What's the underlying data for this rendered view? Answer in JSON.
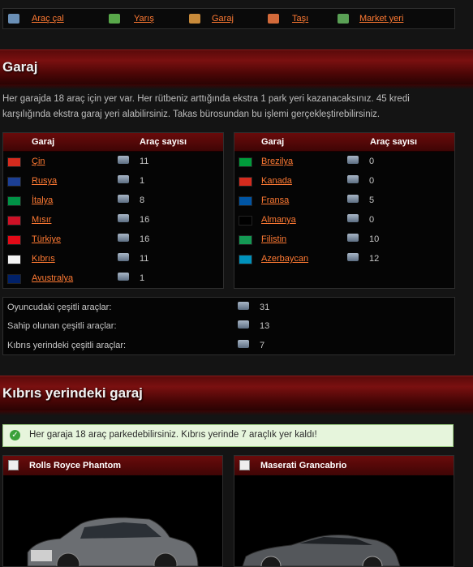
{
  "nav": [
    {
      "label": "Araç çal",
      "icon": "car-steal-icon",
      "color": "#6a8fb6"
    },
    {
      "label": "Yarış",
      "icon": "race-arrows-icon",
      "color": "#59a84a"
    },
    {
      "label": "Garaj",
      "icon": "garage-box-icon",
      "color": "#c88a3a"
    },
    {
      "label": "Taşı",
      "icon": "truck-icon",
      "color": "#d36a3a"
    },
    {
      "label": "Market yeri",
      "icon": "money-icon",
      "color": "#5aa055"
    }
  ],
  "garage_section": {
    "title": "Garaj",
    "intro": "Her garajda 18 araç için yer var. Her rütbeniz arttığında ekstra 1 park yeri kazanacaksınız. 45 kredi karşılığında ekstra garaj yeri alabilirsiniz. Takas bürosundan bu işlemi gerçekleştirebilirsiniz."
  },
  "table_headers": {
    "garage": "Garaj",
    "count": "Araç sayısı"
  },
  "left_garages": [
    {
      "name": "Çin",
      "count": "11",
      "flag": "#d52b1e"
    },
    {
      "name": "Rusya",
      "count": "1",
      "flag": "#1c3f94"
    },
    {
      "name": "İtalya",
      "count": "8",
      "flag": "#009246"
    },
    {
      "name": "Mısır",
      "count": "16",
      "flag": "#ce1126"
    },
    {
      "name": "Türkiye",
      "count": "16",
      "flag": "#e30a17"
    },
    {
      "name": "Kıbrıs",
      "count": "11",
      "flag": "#f3f3f3"
    },
    {
      "name": "Avustralya",
      "count": "1",
      "flag": "#012169"
    }
  ],
  "right_garages": [
    {
      "name": "Brezilya",
      "count": "0",
      "flag": "#009c3b"
    },
    {
      "name": "Kanada",
      "count": "0",
      "flag": "#d52b1e"
    },
    {
      "name": "Fransa",
      "count": "5",
      "flag": "#0055a4"
    },
    {
      "name": "Almanya",
      "count": "0",
      "flag": "#000000"
    },
    {
      "name": "Filistin",
      "count": "10",
      "flag": "#149954"
    },
    {
      "name": "Azerbaycan",
      "count": "12",
      "flag": "#0092bc"
    }
  ],
  "stats": [
    {
      "label": "Oyuncudaki çeşitli araçlar:",
      "value": "31"
    },
    {
      "label": "Sahip olunan çeşitli araçlar:",
      "value": "13"
    },
    {
      "label": "Kıbrıs yerindeki çeşitli araçlar:",
      "value": "7"
    }
  ],
  "local_section": {
    "title": "Kıbrıs yerindeki garaj"
  },
  "notice": "Her garaja 18 araç parkedebilirsiniz. Kıbrıs yerinde 7 araçlık yer kaldı!",
  "cars": [
    {
      "name": "Rolls Royce Phantom"
    },
    {
      "name": "Maserati Grancabrio"
    }
  ]
}
